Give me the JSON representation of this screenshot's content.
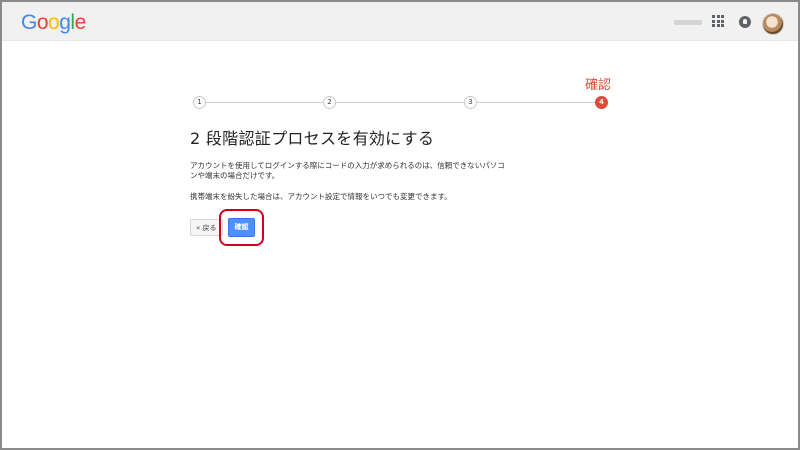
{
  "header": {
    "logo_letters": [
      {
        "char": "G",
        "color": "#4285f4"
      },
      {
        "char": "o",
        "color": "#ea4335"
      },
      {
        "char": "o",
        "color": "#fbbc05"
      },
      {
        "char": "g",
        "color": "#4285f4"
      },
      {
        "char": "l",
        "color": "#34a853"
      },
      {
        "char": "e",
        "color": "#ea4335"
      }
    ],
    "icons": [
      "apps-grid-icon",
      "notifications-icon",
      "avatar"
    ]
  },
  "stepper": {
    "steps": [
      "1",
      "2",
      "3",
      "4"
    ],
    "active_step": 4,
    "active_label": "確認",
    "accent_color": "#dd4b39"
  },
  "main": {
    "title": "2 段階認証プロセスを有効にする",
    "description_1": "アカウントを使用してログインする際にコードの入力が求められるのは、信頼できないパソコンや端末の場合だけです。",
    "description_2": "携帯端末を紛失した場合は、アカウント設定で情報をいつでも変更できます。",
    "back_button": "« 戻る",
    "confirm_button": "確認",
    "confirm_color": "#4d90fe",
    "highlight_color": "#d0021b"
  }
}
